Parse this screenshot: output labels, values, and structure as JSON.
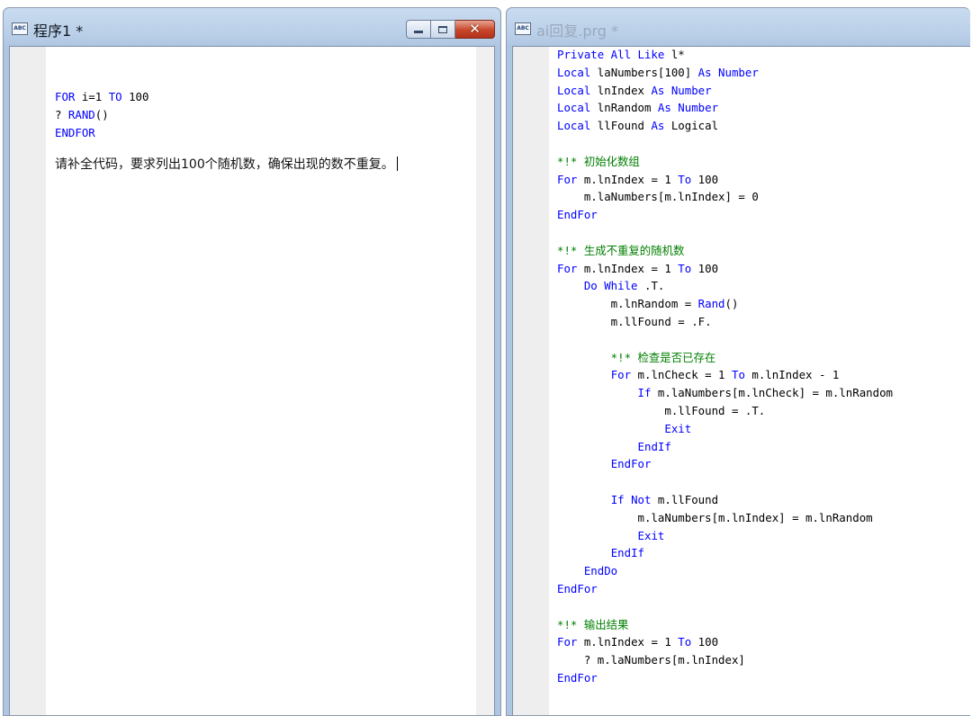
{
  "left_window": {
    "title": "程序1 *",
    "code_lines": [
      [
        {
          "t": "kw",
          "v": "FOR"
        },
        {
          "t": "tx",
          "v": " i=1 "
        },
        {
          "t": "kw",
          "v": "TO"
        },
        {
          "t": "tx",
          "v": " 100"
        }
      ],
      [
        {
          "t": "tx",
          "v": "? "
        },
        {
          "t": "kw",
          "v": "RAND"
        },
        {
          "t": "tx",
          "v": "()"
        }
      ],
      [
        {
          "t": "kw",
          "v": "ENDFOR"
        }
      ]
    ],
    "prompt_text": "请补全代码，要求列出100个随机数，确保出现的数不重复。"
  },
  "right_window": {
    "title": "ai回复.prg *",
    "code_lines": [
      [
        {
          "t": "kw",
          "v": "Private All Like"
        },
        {
          "t": "tx",
          "v": " l*"
        }
      ],
      [
        {
          "t": "kw",
          "v": "Local"
        },
        {
          "t": "tx",
          "v": " laNumbers[100] "
        },
        {
          "t": "kw",
          "v": "As Number"
        }
      ],
      [
        {
          "t": "kw",
          "v": "Local"
        },
        {
          "t": "tx",
          "v": " lnIndex "
        },
        {
          "t": "kw",
          "v": "As Number"
        }
      ],
      [
        {
          "t": "kw",
          "v": "Local"
        },
        {
          "t": "tx",
          "v": " lnRandom "
        },
        {
          "t": "kw",
          "v": "As Number"
        }
      ],
      [
        {
          "t": "kw",
          "v": "Local"
        },
        {
          "t": "tx",
          "v": " llFound "
        },
        {
          "t": "kw",
          "v": "As"
        },
        {
          "t": "tx",
          "v": " Logical"
        }
      ],
      [],
      [
        {
          "t": "cm",
          "v": "*!* 初始化数组"
        }
      ],
      [
        {
          "t": "kw",
          "v": "For"
        },
        {
          "t": "tx",
          "v": " m.lnIndex = 1 "
        },
        {
          "t": "kw",
          "v": "To"
        },
        {
          "t": "tx",
          "v": " 100"
        }
      ],
      [
        {
          "t": "tx",
          "v": "    m.laNumbers[m.lnIndex] = 0"
        }
      ],
      [
        {
          "t": "kw",
          "v": "EndFor"
        }
      ],
      [],
      [
        {
          "t": "cm",
          "v": "*!* 生成不重复的随机数"
        }
      ],
      [
        {
          "t": "kw",
          "v": "For"
        },
        {
          "t": "tx",
          "v": " m.lnIndex = 1 "
        },
        {
          "t": "kw",
          "v": "To"
        },
        {
          "t": "tx",
          "v": " 100"
        }
      ],
      [
        {
          "t": "tx",
          "v": "    "
        },
        {
          "t": "kw",
          "v": "Do While"
        },
        {
          "t": "tx",
          "v": " .T."
        }
      ],
      [
        {
          "t": "tx",
          "v": "        m.lnRandom = "
        },
        {
          "t": "kw",
          "v": "Rand"
        },
        {
          "t": "tx",
          "v": "()"
        }
      ],
      [
        {
          "t": "tx",
          "v": "        m.llFound = .F."
        }
      ],
      [],
      [
        {
          "t": "cm",
          "v": "        *!* 检查是否已存在"
        }
      ],
      [
        {
          "t": "tx",
          "v": "        "
        },
        {
          "t": "kw",
          "v": "For"
        },
        {
          "t": "tx",
          "v": " m.lnCheck = 1 "
        },
        {
          "t": "kw",
          "v": "To"
        },
        {
          "t": "tx",
          "v": " m.lnIndex - 1"
        }
      ],
      [
        {
          "t": "tx",
          "v": "            "
        },
        {
          "t": "kw",
          "v": "If"
        },
        {
          "t": "tx",
          "v": " m.laNumbers[m.lnCheck] = m.lnRandom"
        }
      ],
      [
        {
          "t": "tx",
          "v": "                m.llFound = .T."
        }
      ],
      [
        {
          "t": "tx",
          "v": "                "
        },
        {
          "t": "kw",
          "v": "Exit"
        }
      ],
      [
        {
          "t": "tx",
          "v": "            "
        },
        {
          "t": "kw",
          "v": "EndIf"
        }
      ],
      [
        {
          "t": "tx",
          "v": "        "
        },
        {
          "t": "kw",
          "v": "EndFor"
        }
      ],
      [],
      [
        {
          "t": "tx",
          "v": "        "
        },
        {
          "t": "kw",
          "v": "If Not"
        },
        {
          "t": "tx",
          "v": " m.llFound"
        }
      ],
      [
        {
          "t": "tx",
          "v": "            m.laNumbers[m.lnIndex] = m.lnRandom"
        }
      ],
      [
        {
          "t": "tx",
          "v": "            "
        },
        {
          "t": "kw",
          "v": "Exit"
        }
      ],
      [
        {
          "t": "tx",
          "v": "        "
        },
        {
          "t": "kw",
          "v": "EndIf"
        }
      ],
      [
        {
          "t": "tx",
          "v": "    "
        },
        {
          "t": "kw",
          "v": "EndDo"
        }
      ],
      [
        {
          "t": "kw",
          "v": "EndFor"
        }
      ],
      [],
      [
        {
          "t": "cm",
          "v": "*!* 输出结果"
        }
      ],
      [
        {
          "t": "kw",
          "v": "For"
        },
        {
          "t": "tx",
          "v": " m.lnIndex = 1 "
        },
        {
          "t": "kw",
          "v": "To"
        },
        {
          "t": "tx",
          "v": " 100"
        }
      ],
      [
        {
          "t": "tx",
          "v": "    ? m.laNumbers[m.lnIndex]"
        }
      ],
      [
        {
          "t": "kw",
          "v": "EndFor"
        }
      ]
    ]
  },
  "icons": {
    "window_icon": "ABC",
    "minimize": "minimize-icon",
    "maximize": "maximize-icon",
    "close": "close-icon"
  },
  "colors": {
    "keyword": "#0000ff",
    "comment": "#008000",
    "text": "#000000",
    "title_active": "#101820",
    "title_inactive": "#9aa9bc"
  }
}
